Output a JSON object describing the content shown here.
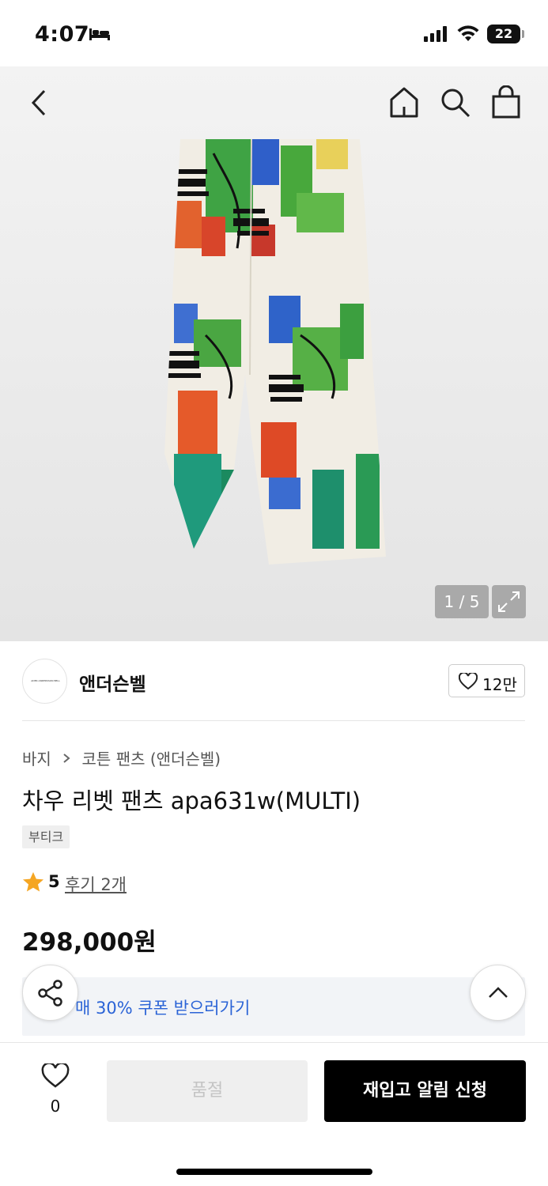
{
  "status_bar": {
    "time": "4:07",
    "battery": "22",
    "icons": [
      "bed-icon",
      "signal-icon",
      "wifi-icon",
      "battery-icon"
    ]
  },
  "header": {
    "icons": [
      "back-icon",
      "home-icon",
      "search-icon",
      "shopping-bag-icon"
    ]
  },
  "gallery": {
    "page_indicator": "1 / 5",
    "current_page": 1,
    "total_pages": 5
  },
  "brand": {
    "logo_text": "ADER ANDERSSON BELL",
    "name": "앤더슨벨",
    "likes": "12만"
  },
  "product": {
    "breadcrumb": [
      "바지",
      "코튼 팬츠 (앤더슨벨)"
    ],
    "title": "차우 리벳 팬츠 apa631w(MULTI)",
    "tag": "부티크",
    "rating": "5",
    "reviews": "후기 2개",
    "price": "298,000원"
  },
  "coupon": {
    "text": "매 30% 쿠폰 받으러가기"
  },
  "bottom_bar": {
    "wish_count": "0",
    "soldout_label": "품절",
    "restock_label": "재입고 알림 신청"
  },
  "colors": {
    "accent_blue": "#2a63d6",
    "star": "#f5a623",
    "primary_button": "#000000"
  }
}
